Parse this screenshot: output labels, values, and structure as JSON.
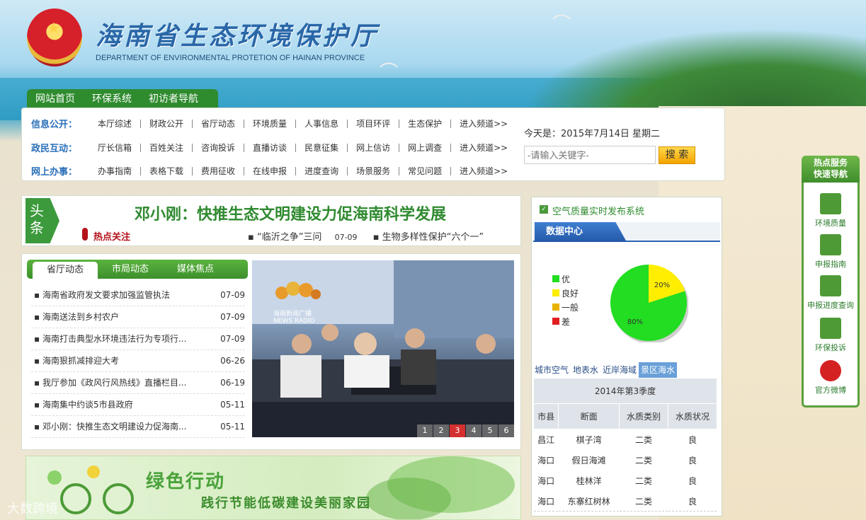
{
  "header": {
    "title": "海南省生态环境保护厅",
    "subtitle": "DEPARTMENT OF ENVIRONMENTAL PROTETION OF HAINAN PROVINCE",
    "tabs": [
      "网站首页",
      "环保系统",
      "初访者导航"
    ]
  },
  "nav": {
    "rows": [
      {
        "label": "信息公开：",
        "items": [
          "本厅综述",
          "财政公开",
          "省厅动态",
          "环境质量",
          "人事信息",
          "项目环评",
          "生态保护",
          "进入频道>>"
        ]
      },
      {
        "label": "政民互动：",
        "items": [
          "厅长信箱",
          "百姓关注",
          "咨询投诉",
          "直播访谈",
          "民意征集",
          "网上信访",
          "网上调查",
          "进入频道>>"
        ]
      },
      {
        "label": "网上办事：",
        "items": [
          "办事指南",
          "表格下载",
          "费用征收",
          "在线申报",
          "进度查询",
          "场景服务",
          "常见问题",
          "进入频道>>"
        ]
      }
    ],
    "today": "今天是：2015年7月14日  星期二",
    "search_placeholder": "-请输入关键字-",
    "search_button": "搜 索"
  },
  "headline": {
    "tag": "头条",
    "title": "邓小刚：快推生态文明建设力促海南科学发展",
    "hot_label": "热点关注",
    "ticker": [
      {
        "text": "“临沂之争”三问",
        "date": "07-09"
      },
      {
        "text": "生物多样性保护“六个一”",
        "date": ""
      }
    ]
  },
  "news": {
    "tabs": [
      "省厅动态",
      "市局动态",
      "媒体焦点"
    ],
    "items": [
      {
        "title": "海南省政府发文要求加强监管执法",
        "date": "07-09"
      },
      {
        "title": "海南送法到乡村农户",
        "date": "07-09"
      },
      {
        "title": "海南打击典型水环境违法行为专项行...",
        "date": "07-09"
      },
      {
        "title": "海南狠抓减排迎大考",
        "date": "06-26"
      },
      {
        "title": "我厅参加《政风行风热线》直播栏目...",
        "date": "06-19"
      },
      {
        "title": "海南集中约谈5市县政府",
        "date": "05-11"
      },
      {
        "title": "邓小刚：快推生态文明建设力促海南...",
        "date": "05-11"
      }
    ],
    "photo_caption": "海南新闻广播 NEWS RADIO",
    "pages": [
      "1",
      "2",
      "3",
      "4",
      "5",
      "6"
    ],
    "active_page": 3
  },
  "banner": {
    "line1": "绿色行动",
    "line2": "践行节能低碳建设美丽家园"
  },
  "watermark": "大数跨境",
  "air": {
    "title": "空气质量实时发布系统",
    "data_center": "数据中心",
    "legend": [
      {
        "label": "优",
        "color": "#22dd22"
      },
      {
        "label": "良好",
        "color": "#ffee00"
      },
      {
        "label": "一般",
        "color": "#e8b200"
      },
      {
        "label": "差",
        "color": "#e02020"
      }
    ],
    "chart_data": {
      "type": "pie",
      "labels": [
        "优",
        "良好"
      ],
      "values": [
        80,
        20
      ],
      "value_labels": [
        "80%",
        "20%"
      ],
      "colors": [
        "#22dd22",
        "#ffee00"
      ]
    },
    "tabs": [
      "城市空气",
      "地表水",
      "近岸海域",
      "景区海水"
    ],
    "active_tab": 3,
    "season": "2014年第3季度",
    "columns": [
      "市县",
      "断面",
      "水质类别",
      "水质状况"
    ],
    "rows": [
      [
        "昌江",
        "棋子湾",
        "二类",
        "良"
      ],
      [
        "海口",
        "假日海滩",
        "二类",
        "良"
      ],
      [
        "海口",
        "桂林洋",
        "二类",
        "良"
      ],
      [
        "海口",
        "东寨红树林",
        "二类",
        "良"
      ]
    ]
  },
  "service": {
    "head1": "热点服务",
    "head2": "快速导航",
    "items": [
      "环境质量",
      "申报指南",
      "申报进度查询",
      "环保投诉",
      "官方微博"
    ]
  }
}
